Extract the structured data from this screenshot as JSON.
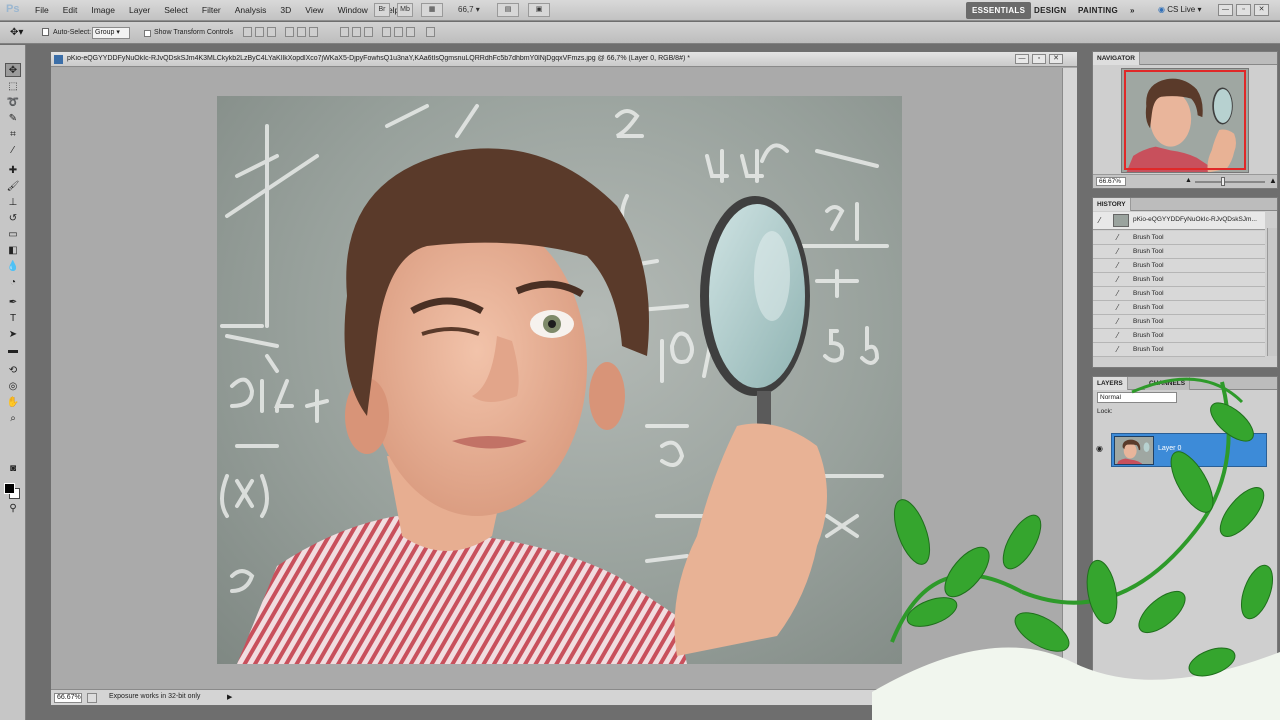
{
  "app": {
    "logo": "Ps",
    "menu": [
      "File",
      "Edit",
      "Image",
      "Layer",
      "Select",
      "Filter",
      "Analysis",
      "3D",
      "View",
      "Window",
      "Help"
    ],
    "zoom_select": "66,7",
    "workspaces": [
      "ESSENTIALS",
      "DESIGN",
      "PAINTING"
    ],
    "workspace_more": "»",
    "cs_live": "CS Live"
  },
  "options": {
    "auto_select_label": "Auto-Select:",
    "auto_select_value": "Group",
    "show_transform": "Show Transform Controls"
  },
  "document": {
    "title": "pKio-eQGYYDDFyNuOkIc-RJvQDskSJm4K3MLCkykb2LzByC4LYaKIlkXopdlXco7jWKaX5-DjpyFowhsQ1u3naY,KAa6tIsQgmsnuLQRRdhFc5b7dhbmY0lNjDgqxVFmzs.jpg @ 66,7% (Layer 0, RGB/8#) *",
    "zoom": "66.67%",
    "status": "Exposure works in 32-bit only",
    "status_arrow": "▶"
  },
  "navigator": {
    "tab": "NAVIGATOR",
    "zoom": "66.67%"
  },
  "history": {
    "tab": "HISTORY",
    "snapshot": "pKio-eQGYYDDFyNuOkIc-RJvQDskSJm...",
    "items": [
      "Brush Tool",
      "Brush Tool",
      "Brush Tool",
      "Brush Tool",
      "Brush Tool",
      "Brush Tool",
      "Brush Tool",
      "Brush Tool",
      "Brush Tool"
    ]
  },
  "layers": {
    "tabs": [
      "LAYERS",
      "CHANNELS"
    ],
    "blend_mode": "Normal",
    "lock_label": "Lock:",
    "layer_name": "Layer 0"
  },
  "colors": {
    "accent": "#3d8bd8",
    "nav_frame": "#e02828",
    "shirt": "#c8505c",
    "vine": "#2e9a2a"
  }
}
